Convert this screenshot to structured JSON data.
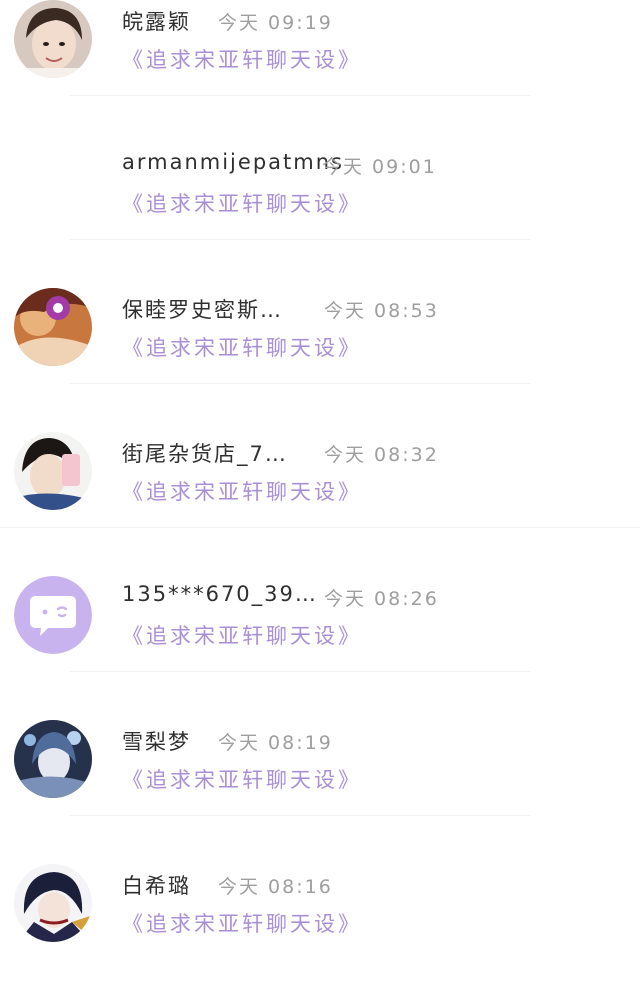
{
  "messages": [
    {
      "name": "皖露颖",
      "time": "今天 09:19",
      "preview": "《追求宋亚轩聊天设》",
      "avatar": "photo-avatar-girl"
    },
    {
      "name": "armanmijepatmns",
      "time": "今天 09:01",
      "preview": "《追求宋亚轩聊天设》",
      "avatar": "none"
    },
    {
      "name": "保睦罗史密斯…",
      "time": "今天 08:53",
      "preview": "《追求宋亚轩聊天设》",
      "avatar": "anime-avatar-orange"
    },
    {
      "name": "街尾杂货店_7…",
      "time": "今天 08:32",
      "preview": "《追求宋亚轩聊天设》",
      "avatar": "photo-avatar-selfie"
    },
    {
      "name": "135***670_39…",
      "time": "今天 08:26",
      "preview": "《追求宋亚轩聊天设》",
      "avatar": "default-chat-avatar"
    },
    {
      "name": "雪梨梦",
      "time": "今天 08:19",
      "preview": "《追求宋亚轩聊天设》",
      "avatar": "anime-avatar-blue"
    },
    {
      "name": "白希璐",
      "time": "今天 08:16",
      "preview": "《追求宋亚轩聊天设》",
      "avatar": "anime-avatar-dark"
    }
  ],
  "colors": {
    "preview": "#a98fd8",
    "name": "#2f2f2f",
    "time": "#9e9e9e",
    "default_avatar": "#c9b3ef"
  }
}
